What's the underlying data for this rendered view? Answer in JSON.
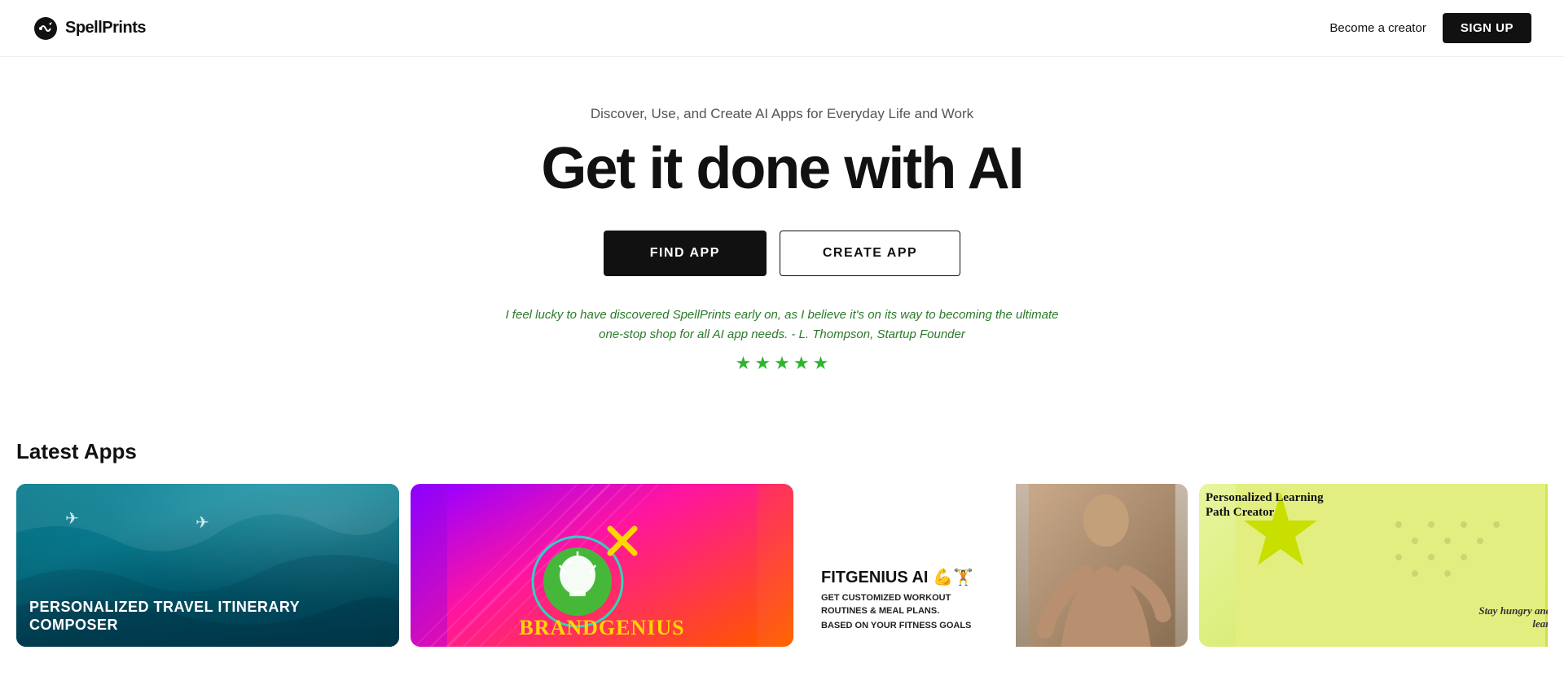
{
  "nav": {
    "logo_text": "SpellPrints",
    "become_creator": "Become a creator",
    "signup": "SIGN UP"
  },
  "hero": {
    "subtitle": "Discover, Use, and Create AI Apps for Everyday Life and Work",
    "title": "Get it done with AI",
    "btn_find": "FIND APP",
    "btn_create": "CREATE APP",
    "testimonial": "I feel lucky to have discovered SpellPrints early on, as I believe it's on its way to becoming the ultimate one-stop shop for all AI app needs. - L. Thompson, Startup Founder",
    "stars": 5
  },
  "latest": {
    "section_title": "Latest Apps",
    "apps": [
      {
        "id": "travel",
        "title": "PERSONALIZED TRAVEL ITINERARY COMPOSER",
        "type": "travel"
      },
      {
        "id": "brandgenius",
        "title": "BrANDGENIUS",
        "type": "brand"
      },
      {
        "id": "fitgenius",
        "title": "FITGENIUS AI",
        "subtitle": "GET CUSTOMIZED WORKOUT ROUTINES & MEAL PLANS.",
        "based": "BASED ON YOUR FITNESS GOALS",
        "type": "fit"
      },
      {
        "id": "learning",
        "title": "Personalized Learning Path Creator",
        "subtitle": "Stay hungry and keep learning!",
        "type": "learn"
      }
    ]
  }
}
